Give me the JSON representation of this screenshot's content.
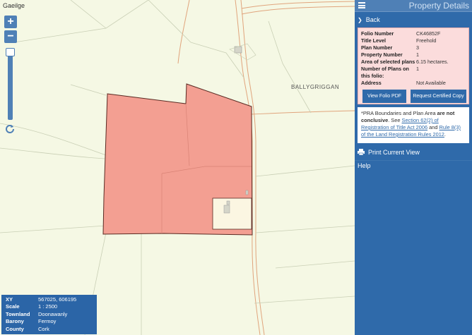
{
  "map": {
    "language_link": "Gaeilge",
    "zoom_in": "+",
    "zoom_out": "−",
    "townland_label": "BALLYGRIGGAN"
  },
  "info_box": {
    "rows": [
      {
        "key": "XY",
        "value": "567025, 606195"
      },
      {
        "key": "Scale",
        "value": "1 : 2500"
      },
      {
        "key": "Townland",
        "value": "Doonawanly"
      },
      {
        "key": "Barony",
        "value": "Fermoy"
      },
      {
        "key": "County",
        "value": "Cork"
      }
    ]
  },
  "panel": {
    "title": "Property Details",
    "back_label": "Back",
    "folio": [
      {
        "key": "Folio Number",
        "value": "CK46852F"
      },
      {
        "key": "Title Level",
        "value": "Freehold"
      },
      {
        "key": "Plan Number",
        "value": "3"
      },
      {
        "key": "Property Number",
        "value": "1"
      },
      {
        "key": "Area of selected plans",
        "value": "6.15 hectares."
      },
      {
        "key": "Number of Plans on this folio:",
        "value": "1"
      },
      {
        "key": "Address",
        "value": "Not Available"
      }
    ],
    "view_pdf_label": "View Folio PDF",
    "request_cert_label": "Request Certified Copy",
    "disclaimer": {
      "part1": "*PRA Boundaries and Plan Area ",
      "bold": "are not conclusive",
      "part2": ". See ",
      "link1": "Section 62(2) of Registration of Title Act 2006",
      "part3": " and ",
      "link2": "Rule 8(3) of the Land Registration Rules 2012",
      "part4": "."
    },
    "print_label": "Print Current View",
    "help_label": "Help"
  },
  "colors": {
    "parcel_fill": "#f39f92",
    "parcel_stroke": "#5a2a22",
    "panel_bg": "#2f6aaa",
    "card_bg": "#fbdcdc"
  }
}
